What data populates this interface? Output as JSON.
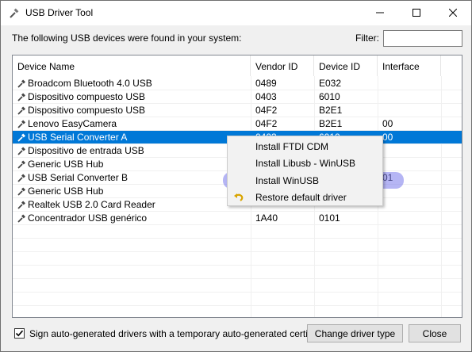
{
  "window": {
    "title": "USB Driver Tool",
    "icons": {
      "app": "usb-plug-icon",
      "minimize": "minimize-icon",
      "maximize": "maximize-icon",
      "close": "close-icon"
    }
  },
  "header": {
    "found_text": "The following USB devices were found in your system:",
    "filter_label": "Filter:",
    "filter_value": ""
  },
  "table": {
    "columns": [
      "Device Name",
      "Vendor ID",
      "Device ID",
      "Interface"
    ],
    "rows": [
      {
        "name": "Broadcom Bluetooth 4.0 USB",
        "vendor": "0489",
        "device": "E032",
        "interface": ""
      },
      {
        "name": "Dispositivo compuesto USB",
        "vendor": "0403",
        "device": "6010",
        "interface": ""
      },
      {
        "name": "Dispositivo compuesto USB",
        "vendor": "04F2",
        "device": "B2E1",
        "interface": ""
      },
      {
        "name": "Lenovo EasyCamera",
        "vendor": "04F2",
        "device": "B2E1",
        "interface": "00"
      },
      {
        "name": "USB Serial Converter A",
        "vendor": "0403",
        "device": "6010",
        "interface": "00",
        "selected": true
      },
      {
        "name": "Dispositivo de entrada USB",
        "vendor": "",
        "device": "",
        "interface": ""
      },
      {
        "name": "Generic USB Hub",
        "vendor": "",
        "device": "",
        "interface": ""
      },
      {
        "name": "USB Serial Converter B",
        "vendor": "",
        "device": "",
        "interface": "01"
      },
      {
        "name": "Generic USB Hub",
        "vendor": "",
        "device": "",
        "interface": ""
      },
      {
        "name": "Realtek USB 2.0 Card Reader",
        "vendor": "",
        "device": "",
        "interface": ""
      },
      {
        "name": "Concentrador USB genérico",
        "vendor": "1A40",
        "device": "0101",
        "interface": ""
      }
    ],
    "row_icon": "usb-plug-icon"
  },
  "context_menu": {
    "items": [
      {
        "label": "Install FTDI CDM",
        "icon": ""
      },
      {
        "label": "Install Libusb - WinUSB",
        "icon": ""
      },
      {
        "label": "Install WinUSB",
        "icon": "",
        "highlighted": true
      },
      {
        "label": "Restore default driver",
        "icon": "undo-arrow-icon"
      }
    ],
    "highlight_color": "#7878eb"
  },
  "footer": {
    "checkbox_checked": true,
    "checkbox_label": "Sign auto-generated drivers with a temporary auto-generated certificate",
    "change_button": "Change driver type",
    "close_button": "Close"
  },
  "colors": {
    "selection": "#0078d7",
    "window_bg": "#f0f0f0"
  }
}
